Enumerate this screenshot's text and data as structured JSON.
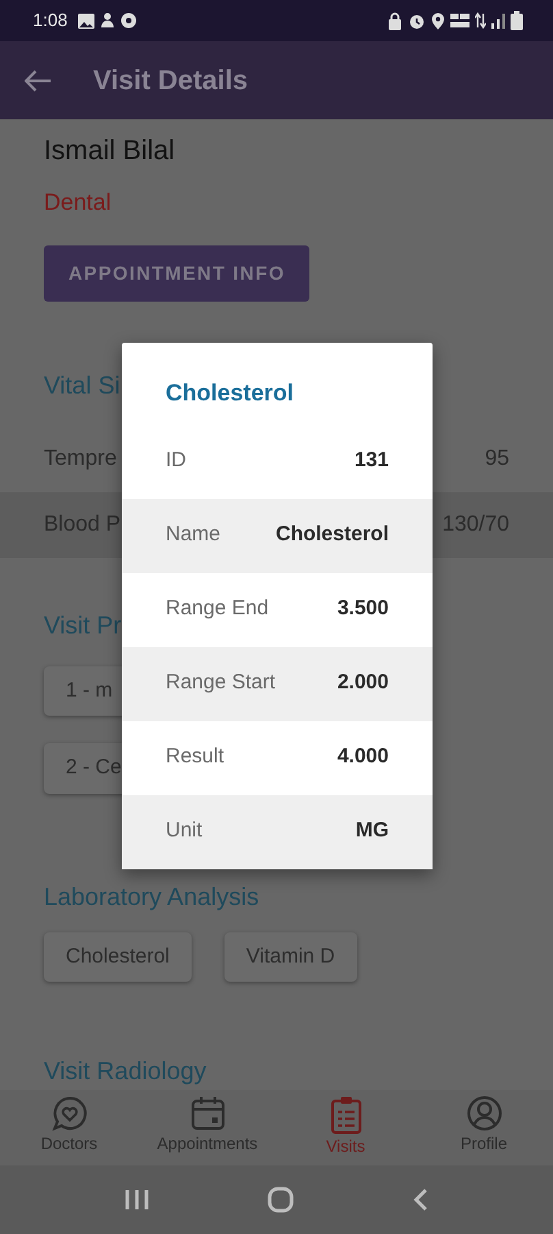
{
  "status_bar": {
    "time": "1:08"
  },
  "app_bar": {
    "title": "Visit Details"
  },
  "patient": {
    "name": "Ismail Bilal",
    "department": "Dental"
  },
  "appointment_button": "APPOINTMENT INFO",
  "vital_signs": {
    "heading": "Vital Si",
    "rows": [
      {
        "label": "Tempre",
        "value": "95"
      },
      {
        "label": "Blood P",
        "value": "130/70"
      }
    ]
  },
  "visit_procedures": {
    "heading": "Visit Pr",
    "chips": [
      "1 - m",
      "2 - Ce"
    ]
  },
  "laboratory_analysis": {
    "heading": "Laboratory Analysis",
    "chips": [
      "Cholesterol",
      "Vitamin D"
    ]
  },
  "visit_radiology": {
    "heading": "Visit Radiology"
  },
  "bottom_nav": [
    {
      "label": "Doctors",
      "selected": false
    },
    {
      "label": "Appointments",
      "selected": false
    },
    {
      "label": "Visits",
      "selected": true
    },
    {
      "label": "Profile",
      "selected": false
    }
  ],
  "dialog": {
    "title": "Cholesterol",
    "rows": [
      {
        "label": "ID",
        "value": "131"
      },
      {
        "label": "Name",
        "value": "Cholesterol"
      },
      {
        "label": "Range End",
        "value": "3.500"
      },
      {
        "label": "Range Start",
        "value": "2.000"
      },
      {
        "label": "Result",
        "value": "4.000"
      },
      {
        "label": "Unit",
        "value": "MG"
      }
    ]
  }
}
